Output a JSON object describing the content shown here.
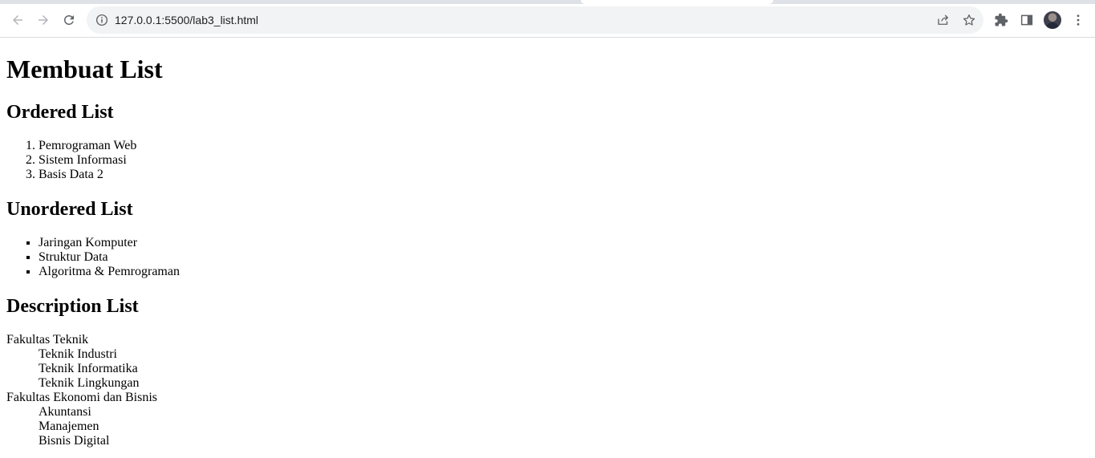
{
  "browser": {
    "url": "127.0.0.1:5500/lab3_list.html",
    "icons": {
      "back": "arrow-left-icon",
      "forward": "arrow-right-icon",
      "reload": "reload-icon",
      "site_info": "info-icon",
      "share": "share-icon",
      "bookmark": "star-icon",
      "extensions": "puzzle-icon",
      "side_panel": "side-panel-icon",
      "menu": "kebab-menu-icon"
    }
  },
  "page": {
    "title": "Membuat List",
    "ordered": {
      "heading": "Ordered List",
      "items": [
        "Pemrograman Web",
        "Sistem Informasi",
        "Basis Data 2"
      ]
    },
    "unordered": {
      "heading": "Unordered List",
      "items": [
        "Jaringan Komputer",
        "Struktur Data",
        "Algoritma & Pemrograman"
      ]
    },
    "description": {
      "heading": "Description List",
      "groups": [
        {
          "term": "Fakultas Teknik",
          "defs": [
            "Teknik Industri",
            "Teknik Informatika",
            "Teknik Lingkungan"
          ]
        },
        {
          "term": "Fakultas Ekonomi dan Bisnis",
          "defs": [
            "Akuntansi",
            "Manajemen",
            "Bisnis Digital"
          ]
        }
      ]
    }
  }
}
